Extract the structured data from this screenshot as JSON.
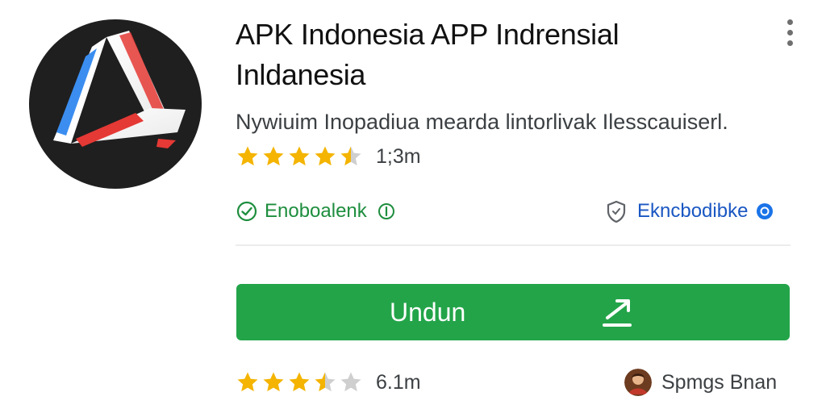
{
  "app": {
    "icon": "app-logo-icon",
    "title_line1": "APK Indonesia APP Indrensial",
    "title_line2": "Inldanesia",
    "description": "Nywiuim Inopadiua mearda lintorlivak Ilesscauiserl."
  },
  "top_rating": {
    "stars": 4.5,
    "count": "1;3m"
  },
  "badge_left": {
    "icon": "check-circle-icon",
    "label": "Enoboalenk",
    "suffix_icon": "info-circle-icon"
  },
  "badge_right": {
    "icon": "shield-icon",
    "label": "Ekncbodibke",
    "suffix_icon": "help-circle-icon"
  },
  "install_button": {
    "label": "Undun",
    "icon": "arrow-up-right-icon"
  },
  "bottom_rating": {
    "stars": 3.5,
    "count": "6.1m"
  },
  "developer": {
    "avatar": "developer-avatar",
    "name": "Spmgs Bnan"
  },
  "colors": {
    "accent_green": "#23a449",
    "badge_green": "#1e8e3e",
    "link_blue": "#1a57c2",
    "star_gold": "#f4b400",
    "star_gray": "#cfcfcf"
  }
}
